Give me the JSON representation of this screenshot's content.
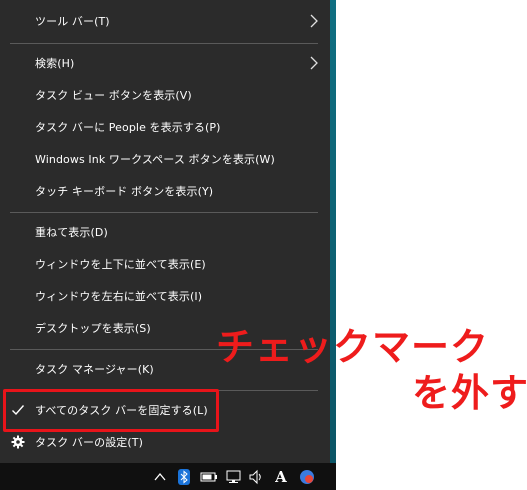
{
  "menu": {
    "toolbar": "ツール バー(T)",
    "search": "検索(H)",
    "task_view": "タスク ビュー ボタンを表示(V)",
    "people": "タスク バーに People を表示する(P)",
    "ink": "Windows Ink ワークスペース ボタンを表示(W)",
    "touch_keyboard": "タッチ キーボード ボタンを表示(Y)",
    "cascade": "重ねて表示(D)",
    "stack": "ウィンドウを上下に並べて表示(E)",
    "side_by_side": "ウィンドウを左右に並べて表示(I)",
    "show_desktop": "デスクトップを表示(S)",
    "task_manager": "タスク マネージャー(K)",
    "lock_all": "すべてのタスク バーを固定する(L)",
    "settings": "タスク バーの設定(T)"
  },
  "annotation": {
    "line1": "チェックマーク",
    "line2": "を外す"
  },
  "tray": {
    "ime": "A"
  },
  "icons": {
    "toolbar_arrow": "chevron-right-icon",
    "search_arrow": "chevron-right-icon",
    "lock_check": "checkmark-icon",
    "settings": "gear-icon",
    "tray": [
      "chevron-up-icon",
      "bluetooth-icon",
      "battery-icon",
      "network-icon",
      "volume-icon",
      "ime-icon",
      "app-icon"
    ]
  },
  "colors": {
    "menu_bg": "#2b2b2b",
    "separator": "#5a5a5a",
    "highlight": "#e8141a",
    "annotation": "#ee1c1c"
  }
}
